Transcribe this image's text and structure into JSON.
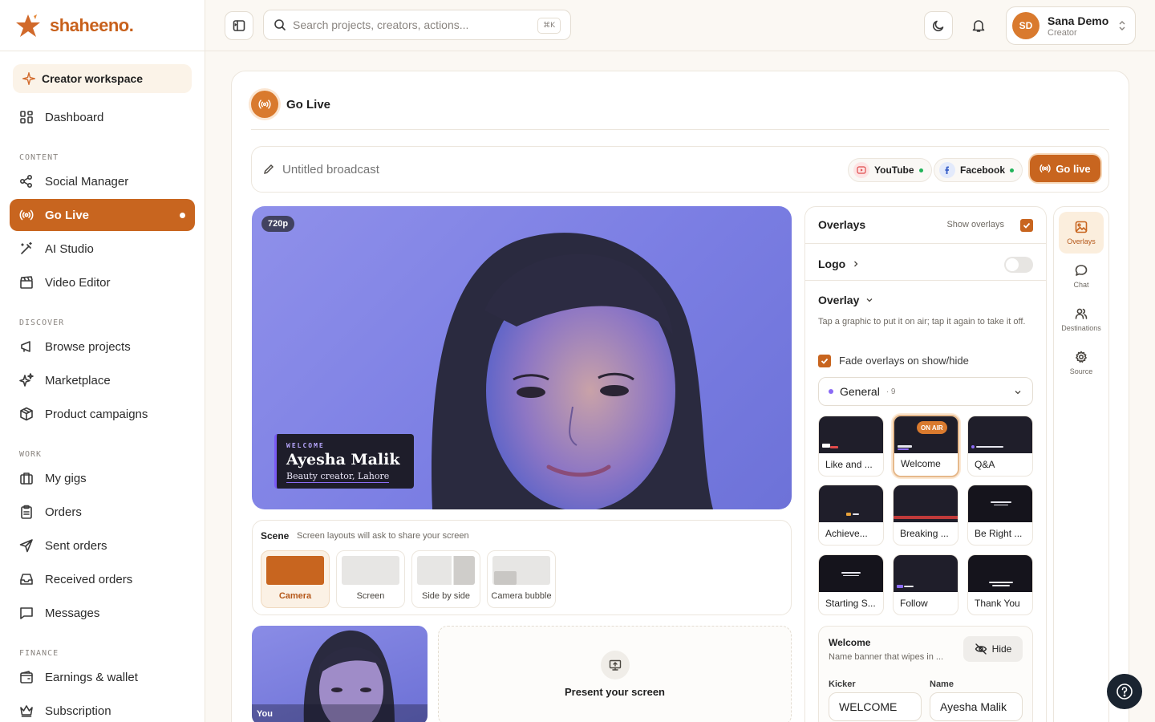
{
  "brand": {
    "name": "shaheeno."
  },
  "sidebar": {
    "workspace": "Creator workspace",
    "items_top": [
      {
        "label": "Dashboard",
        "icon": "dashboard-icon"
      }
    ],
    "sections": [
      {
        "title": "CONTENT",
        "items": [
          {
            "label": "Social Manager",
            "icon": "share-icon"
          },
          {
            "label": "Go Live",
            "icon": "broadcast-icon",
            "active": true
          },
          {
            "label": "AI Studio",
            "icon": "magic-wand-icon"
          },
          {
            "label": "Video Editor",
            "icon": "clapperboard-icon"
          }
        ]
      },
      {
        "title": "DISCOVER",
        "items": [
          {
            "label": "Browse projects",
            "icon": "megaphone-icon"
          },
          {
            "label": "Marketplace",
            "icon": "sparkles-icon"
          },
          {
            "label": "Product campaigns",
            "icon": "package-icon"
          }
        ]
      },
      {
        "title": "WORK",
        "items": [
          {
            "label": "My gigs",
            "icon": "briefcase-icon"
          },
          {
            "label": "Orders",
            "icon": "clipboard-icon"
          },
          {
            "label": "Sent orders",
            "icon": "send-icon"
          },
          {
            "label": "Received orders",
            "icon": "inbox-icon"
          },
          {
            "label": "Messages",
            "icon": "message-icon"
          }
        ]
      },
      {
        "title": "FINANCE",
        "items": [
          {
            "label": "Earnings & wallet",
            "icon": "wallet-icon"
          },
          {
            "label": "Subscription",
            "icon": "crown-icon"
          }
        ]
      }
    ]
  },
  "topbar": {
    "search_placeholder": "Search projects, creators, actions...",
    "shortcut": "⌘K",
    "user": {
      "initials": "SD",
      "name": "Sana Demo",
      "role": "Creator"
    }
  },
  "page": {
    "title": "Go Live",
    "broadcast_title_placeholder": "Untitled broadcast",
    "destinations": [
      {
        "label": "YouTube"
      },
      {
        "label": "Facebook"
      }
    ],
    "go_live_label": "Go live"
  },
  "preview": {
    "resolution": "720p",
    "lower_third": {
      "kicker": "WELCOME",
      "name": "Ayesha Malik",
      "subtitle": "Beauty creator, Lahore"
    }
  },
  "scene": {
    "label": "Scene",
    "hint": "Screen layouts will ask to share your screen",
    "options": [
      "Camera",
      "Screen",
      "Side by side",
      "Camera bubble"
    ],
    "selected": "Camera"
  },
  "tiles": {
    "you_label": "You",
    "present_label": "Present your screen"
  },
  "overlays": {
    "title": "Overlays",
    "show_label": "Show overlays",
    "logo_label": "Logo",
    "overlay_label": "Overlay",
    "description": "Tap a graphic to put it on air; tap it again to take it off.",
    "fade_label": "Fade overlays on show/hide",
    "group": {
      "name": "General",
      "count": "· 9"
    },
    "cards": [
      {
        "label": "Like and ..."
      },
      {
        "label": "Welcome",
        "badge": "ON AIR"
      },
      {
        "label": "Q&A"
      },
      {
        "label": "Achieve..."
      },
      {
        "label": "Breaking ..."
      },
      {
        "label": "Be Right ..."
      },
      {
        "label": "Starting S..."
      },
      {
        "label": "Follow"
      },
      {
        "label": "Thank You"
      }
    ],
    "editor": {
      "title": "Welcome",
      "description": "Name banner that wipes in ...",
      "hide_label": "Hide",
      "kicker_label": "Kicker",
      "kicker_value": "WELCOME",
      "name_label": "Name",
      "name_value": "Ayesha Malik"
    }
  },
  "rail": [
    {
      "label": "Overlays",
      "icon": "image-icon",
      "active": true
    },
    {
      "label": "Chat",
      "icon": "chat-icon"
    },
    {
      "label": "Destinations",
      "icon": "users-icon"
    },
    {
      "label": "Source",
      "icon": "gear-icon"
    }
  ],
  "colors": {
    "accent": "#c8651f",
    "live_dot": "#22b35a",
    "overlay_accent": "#7a5af5"
  }
}
